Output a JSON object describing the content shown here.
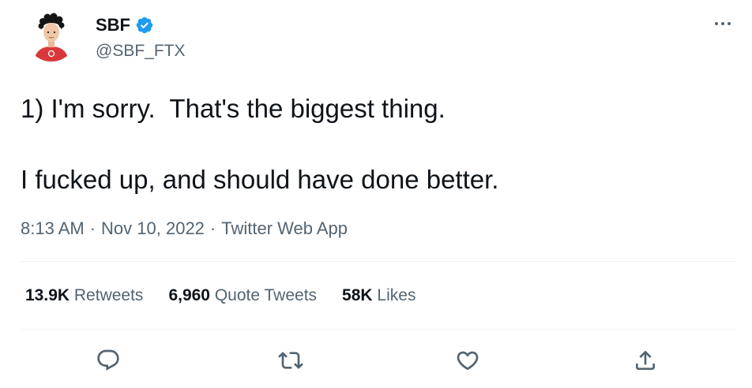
{
  "author": {
    "display_name": "SBF",
    "handle": "@SBF_FTX",
    "verified": true,
    "avatar_icon": "avatar-cartoon-red-shirt",
    "verified_color": "#1d9bf0"
  },
  "tweet": {
    "lines": [
      "1) I'm sorry.  That's the biggest thing.",
      "I fucked up, and should have done better."
    ],
    "time": "8:13 AM",
    "date": "Nov 10, 2022",
    "source": "Twitter Web App",
    "separator": "·"
  },
  "stats": {
    "retweets": {
      "count": "13.9K",
      "label": "Retweets"
    },
    "quotes": {
      "count": "6,960",
      "label": "Quote Tweets"
    },
    "likes": {
      "count": "58K",
      "label": "Likes"
    }
  },
  "actions": [
    {
      "name": "reply",
      "icon": "reply-icon"
    },
    {
      "name": "retweet",
      "icon": "retweet-icon"
    },
    {
      "name": "like",
      "icon": "heart-icon"
    },
    {
      "name": "share",
      "icon": "share-icon"
    }
  ],
  "colors": {
    "text_primary": "#0f1419",
    "text_secondary": "#536471",
    "divider": "#eff3f4",
    "avatar_shirt": "#d8383a"
  }
}
